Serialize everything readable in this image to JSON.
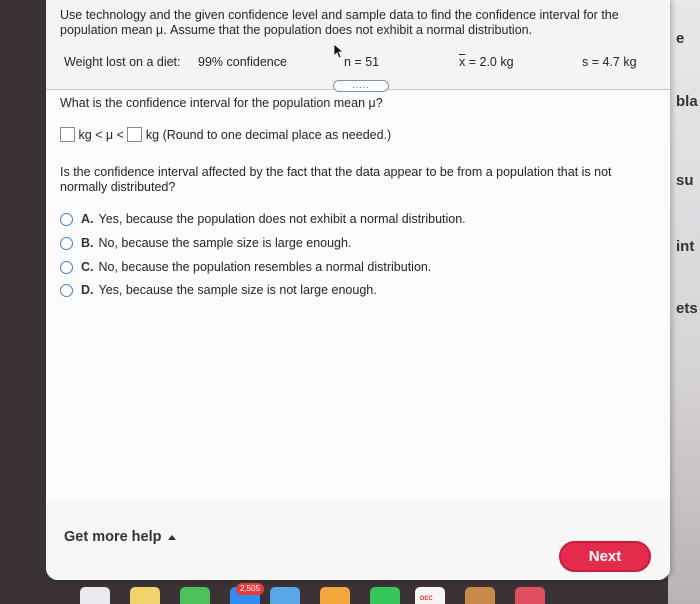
{
  "problem": {
    "intro": "Use technology and the given confidence level and sample data to find the confidence interval for the population mean μ. Assume that the population does not exhibit a normal distribution.",
    "data_row": {
      "label": "Weight lost on a diet:",
      "confidence": "99% confidence",
      "n": "n = 51",
      "xbar_symbol": "x",
      "xbar_value": " = 2.0 kg",
      "s": "s = 4.7 kg"
    },
    "expand_button": "....."
  },
  "question1": {
    "prompt": "What is the confidence interval for the population mean μ?",
    "unit1": "kg < μ <",
    "unit2": "kg (Round to one decimal place as needed.)",
    "lower_value": "",
    "upper_value": ""
  },
  "question2": {
    "prompt": "Is the confidence interval affected by the fact that the data appear to be from a population that is not normally distributed?",
    "options": [
      {
        "letter": "A.",
        "text": "Yes, because the population does not exhibit a normal distribution."
      },
      {
        "letter": "B.",
        "text": "No, because the sample size is large enough."
      },
      {
        "letter": "C.",
        "text": "No, because the population resembles a normal distribution."
      },
      {
        "letter": "D.",
        "text": "Yes, because the sample size is not large enough."
      }
    ]
  },
  "footer": {
    "help": "Get more help",
    "next": "Next"
  },
  "background": {
    "fragments": [
      "e",
      "bla",
      "su",
      "int",
      "ets"
    ]
  },
  "dock": {
    "badge": "2,505",
    "calendar_month": "DEC"
  },
  "colors": {
    "accent": "#e52b4b",
    "radio": "#4e7fc2",
    "divider": "#bfc7cf"
  }
}
